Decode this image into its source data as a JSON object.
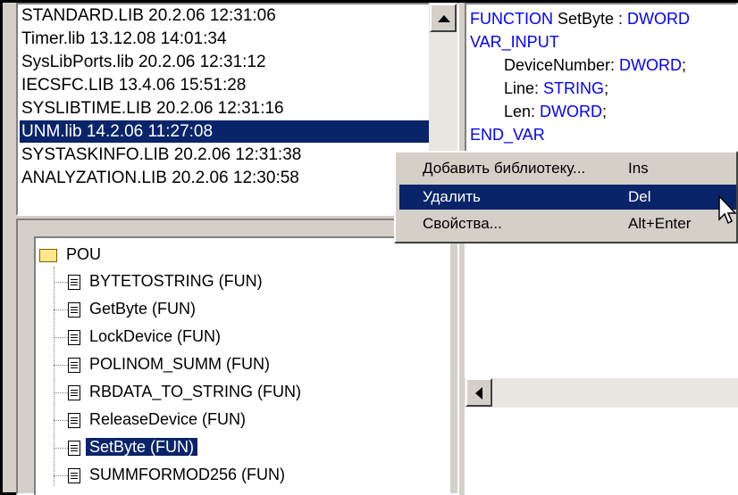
{
  "libraries": [
    "STANDARD.LIB 20.2.06 12:31:06",
    "Timer.lib 13.12.08 14:01:34",
    "SysLibPorts.lib 20.2.06 12:31:12",
    "IECSFC.LIB 13.4.06 15:51:28",
    "SYSLIBTIME.LIB 20.2.06 12:31:16",
    "UNM.lib 14.2.06 11:27:08",
    "SYSTASKINFO.LIB 20.2.06 12:31:38",
    "ANALYZATION.LIB 20.2.06 12:30:58"
  ],
  "selected_library": "UNM.lib 14.2.06 11:27:08",
  "tree": {
    "root": "POU",
    "items": [
      "BYTETOSTRING (FUN)",
      "GetByte (FUN)",
      "LockDevice (FUN)",
      "POLINOM_SUMM (FUN)",
      "RBDATA_TO_STRING (FUN)",
      "ReleaseDevice (FUN)",
      "SetByte (FUN)",
      "SUMMFORMOD256 (FUN)"
    ],
    "selected": "SetByte (FUN)"
  },
  "code": {
    "l1_kw": "FUNCTION",
    "l1_name": " SetByte : ",
    "l1_type": "DWORD",
    "l2": "VAR_INPUT",
    "l3_name": "DeviceNumber: ",
    "l3_type": "DWORD",
    "l3_end": ";",
    "l4_name": "Line: ",
    "l4_type": "STRING",
    "l4_end": ";",
    "l5_name": "Len: ",
    "l5_type": "DWORD",
    "l5_end": ";",
    "l6": "END_VAR"
  },
  "context_menu": [
    {
      "label": "Добавить библиотеку...",
      "shortcut": "Ins"
    },
    {
      "label": "Удалить",
      "shortcut": "Del"
    },
    {
      "label": "Свойства...",
      "shortcut": "Alt+Enter"
    }
  ],
  "context_menu_hover": "Удалить",
  "icons": [
    "folder-icon",
    "document-icon",
    "scroll-up-arrow-icon",
    "scroll-left-arrow-icon",
    "mouse-cursor-icon"
  ],
  "colors": {
    "selection": "#0a246a",
    "keyword": "#0000ff",
    "window_bg": "#d4d0c8"
  }
}
